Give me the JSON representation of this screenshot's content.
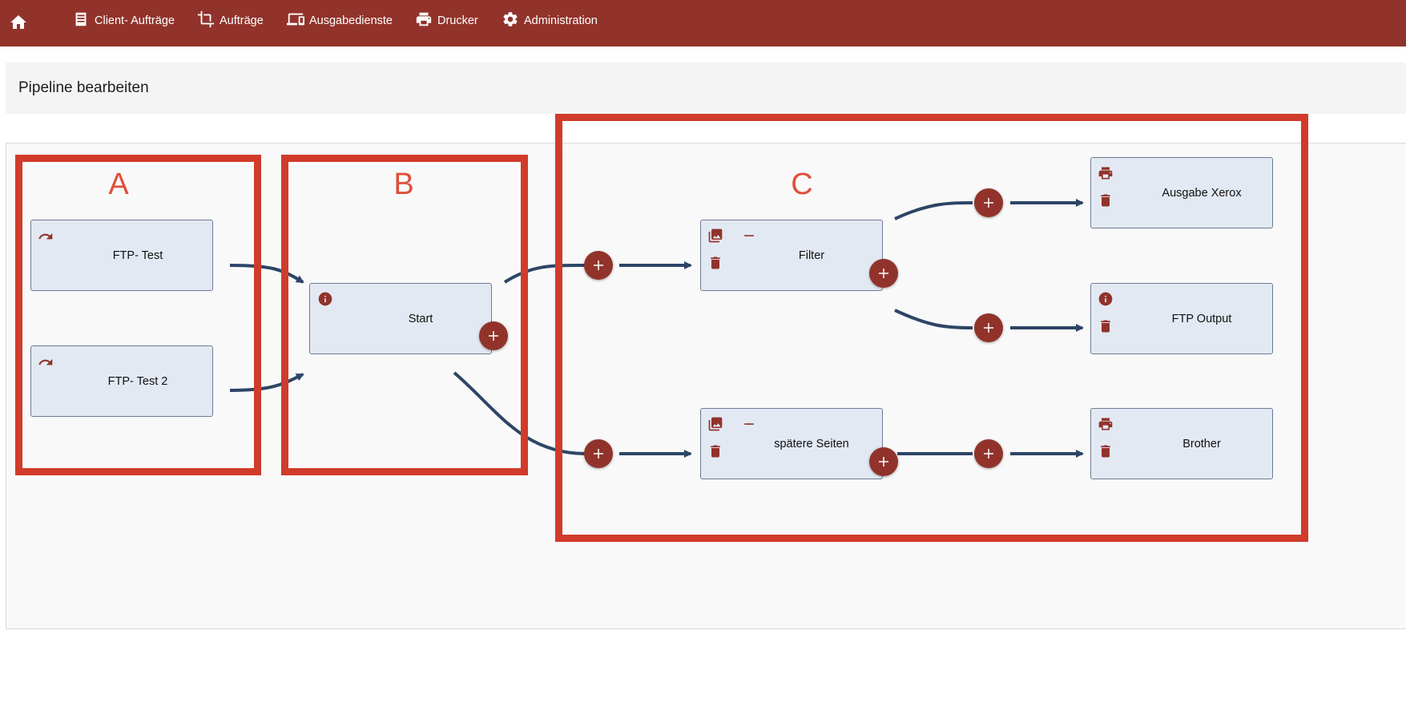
{
  "nav": {
    "home_icon": "home-icon",
    "items": [
      {
        "label": "Client- Aufträge",
        "icon": "list-document-icon"
      },
      {
        "label": "Aufträge",
        "icon": "crop-icon"
      },
      {
        "label": "Ausgabedienste",
        "icon": "devices-icon"
      },
      {
        "label": "Drucker",
        "icon": "printer-icon"
      },
      {
        "label": "Administration",
        "icon": "gear-icon"
      }
    ]
  },
  "page": {
    "title": "Pipeline bearbeiten"
  },
  "regions": {
    "a": "A",
    "b": "B",
    "c": "C"
  },
  "nodes": {
    "ftp_test": {
      "label": "FTP- Test",
      "icon": "redo-arrow-icon"
    },
    "ftp_test_2": {
      "label": "FTP- Test 2",
      "icon": "redo-arrow-icon"
    },
    "start": {
      "label": "Start",
      "icon": "info-icon"
    },
    "filter": {
      "label": "Filter",
      "icons": [
        "images-icon",
        "minus-icon",
        "trash-icon"
      ]
    },
    "spaetere_seiten": {
      "label": "spätere Seiten",
      "icons": [
        "images-icon",
        "minus-icon",
        "trash-icon"
      ]
    },
    "ausgabe_xerox": {
      "label": "Ausgabe Xerox",
      "icons": [
        "printer-icon",
        "trash-icon"
      ]
    },
    "ftp_output": {
      "label": "FTP Output",
      "icons": [
        "info-icon",
        "trash-icon"
      ]
    },
    "brother": {
      "label": "Brother",
      "icons": [
        "printer-icon",
        "trash-icon"
      ]
    }
  },
  "colors": {
    "brand": "#91332b",
    "node_fill": "#e3e9f3",
    "edge": "#2d4566",
    "annotation": "#d13b2b"
  }
}
